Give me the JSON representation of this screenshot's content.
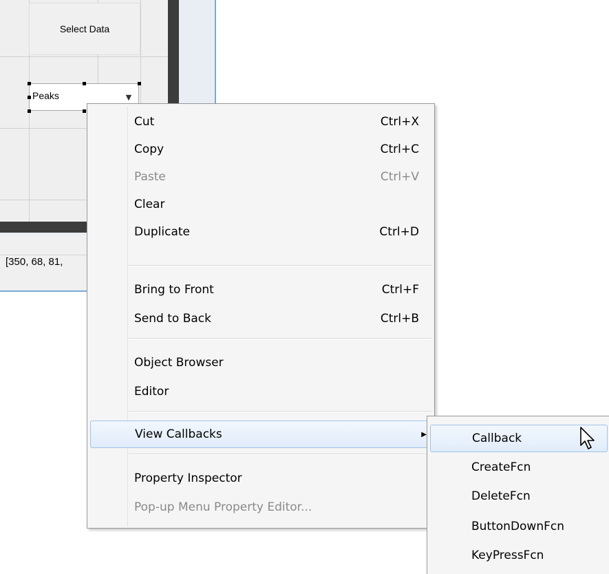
{
  "editor": {
    "select_data_label": "Select Data",
    "popup_value": "Peaks",
    "position_readout": "[350, 68, 81,"
  },
  "context_menu": {
    "items": [
      {
        "label": "Cut",
        "shortcut": "Ctrl+X",
        "enabled": true
      },
      {
        "label": "Copy",
        "shortcut": "Ctrl+C",
        "enabled": true
      },
      {
        "label": "Paste",
        "shortcut": "Ctrl+V",
        "enabled": false
      },
      {
        "label": "Clear",
        "shortcut": "",
        "enabled": true
      },
      {
        "label": "Duplicate",
        "shortcut": "Ctrl+D",
        "enabled": true
      },
      {
        "label": "Bring to Front",
        "shortcut": "Ctrl+F",
        "enabled": true
      },
      {
        "label": "Send to Back",
        "shortcut": "Ctrl+B",
        "enabled": true
      },
      {
        "label": "Object Browser",
        "shortcut": "",
        "enabled": true
      },
      {
        "label": "Editor",
        "shortcut": "",
        "enabled": true
      },
      {
        "label": "View Callbacks",
        "shortcut": "",
        "enabled": true,
        "highlighted": true,
        "has_submenu": true
      },
      {
        "label": "Property Inspector",
        "shortcut": "",
        "enabled": true
      },
      {
        "label": "Pop-up Menu Property Editor...",
        "shortcut": "",
        "enabled": false
      }
    ]
  },
  "callbacks_submenu": {
    "items": [
      {
        "label": "Callback",
        "highlighted": true
      },
      {
        "label": "CreateFcn"
      },
      {
        "label": "DeleteFcn"
      },
      {
        "label": "ButtonDownFcn"
      },
      {
        "label": "KeyPressFcn"
      }
    ]
  },
  "icons": {
    "dropdown_arrow": "dropdown-arrow-icon",
    "submenu_arrow": "submenu-arrow-icon",
    "cursor": "mouse-pointer-icon"
  },
  "colors": {
    "menu_background": "#f5f5f5",
    "highlight_border": "#9fc3ea",
    "disabled_text": "#8a8a8a",
    "editor_frame": "#3c3c3c",
    "window_border": "#7aa7d6"
  }
}
